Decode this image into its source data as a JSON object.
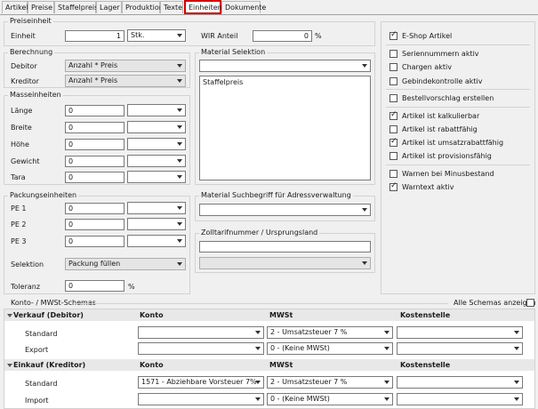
{
  "tabs": [
    "Artikel",
    "Preise",
    "Staffelpreise",
    "Lager",
    "Produktion",
    "Texte",
    "Einheiten",
    "Dokumente"
  ],
  "preiseinheit": {
    "title": "Preiseinheit",
    "einheit_label": "Einheit",
    "einheit_value": "1",
    "einheit_unit": "Stk.",
    "wir_label": "WIR Anteil",
    "wir_value": "0",
    "wir_unit": "%"
  },
  "berechnung": {
    "title": "Berechnung",
    "debitor_label": "Debitor",
    "debitor_value": "Anzahl * Preis",
    "kreditor_label": "Kreditor",
    "kreditor_value": "Anzahl * Preis"
  },
  "material_selektion": {
    "title": "Material Selektion",
    "list_items": [
      "Staffelpreis"
    ]
  },
  "masseinheiten": {
    "title": "Masseinheiten",
    "rows": [
      {
        "label": "Länge",
        "value": "0"
      },
      {
        "label": "Breite",
        "value": "0"
      },
      {
        "label": "Höhe",
        "value": "0"
      },
      {
        "label": "Gewicht",
        "value": "0"
      },
      {
        "label": "Tara",
        "value": "0"
      }
    ]
  },
  "packungseinheiten": {
    "title": "Packungseinheiten",
    "rows": [
      {
        "label": "PE 1",
        "value": "0"
      },
      {
        "label": "PE 2",
        "value": "0"
      },
      {
        "label": "PE 3",
        "value": "0"
      }
    ],
    "selektion_label": "Selektion",
    "selektion_value": "Packung füllen",
    "toleranz_label": "Toleranz",
    "toleranz_value": "0",
    "toleranz_unit": "%"
  },
  "material_suchbegriff": {
    "title": "Material Suchbegriff für Adressverwaltung"
  },
  "zolltarif": {
    "title": "Zolltarifnummer / Ursprungsland",
    "value": ""
  },
  "checkboxes": [
    {
      "label": "E-Shop Artikel",
      "checked": true
    },
    {
      "label": "Seriennummern aktiv",
      "checked": false
    },
    {
      "label": "Chargen aktiv",
      "checked": false
    },
    {
      "label": "Gebindekontrolle aktiv",
      "checked": false
    },
    {
      "label": "Bestellvorschlag erstellen",
      "checked": false
    },
    {
      "label": "Artikel ist kalkulierbar",
      "checked": true
    },
    {
      "label": "Artikel ist rabattfähig",
      "checked": false
    },
    {
      "label": "Artikel ist umsatzrabattfähig",
      "checked": true
    },
    {
      "label": "Artikel ist provisionsfähig",
      "checked": false
    },
    {
      "label": "Warnen bei Minusbestand",
      "checked": false
    },
    {
      "label": "Warntext aktiv",
      "checked": true
    }
  ],
  "konto_mwst": {
    "title": "Konto- / MWSt-Schemas",
    "alle_schemas_label": "Alle Schemas anzeigen",
    "alle_schemas_checked": false,
    "col_konto": "Konto",
    "col_mwst": "MWSt",
    "col_kostenstelle": "Kostenstelle",
    "sections": [
      {
        "title": "Verkauf (Debitor)",
        "rows": [
          {
            "label": "Standard",
            "konto": "",
            "mwst": "2 - Umsatzsteuer 7 %",
            "kostenstelle": ""
          },
          {
            "label": "Export",
            "konto": "",
            "mwst": "0 - (Keine MWSt)",
            "kostenstelle": ""
          }
        ]
      },
      {
        "title": "Einkauf (Kreditor)",
        "rows": [
          {
            "label": "Standard",
            "konto": "1571 - Abziehbare Vorsteuer 7%",
            "mwst": "2 - Umsatzsteuer 7 %",
            "kostenstelle": ""
          },
          {
            "label": "Import",
            "konto": "",
            "mwst": "0 - (Keine MWSt)",
            "kostenstelle": ""
          }
        ]
      }
    ]
  }
}
